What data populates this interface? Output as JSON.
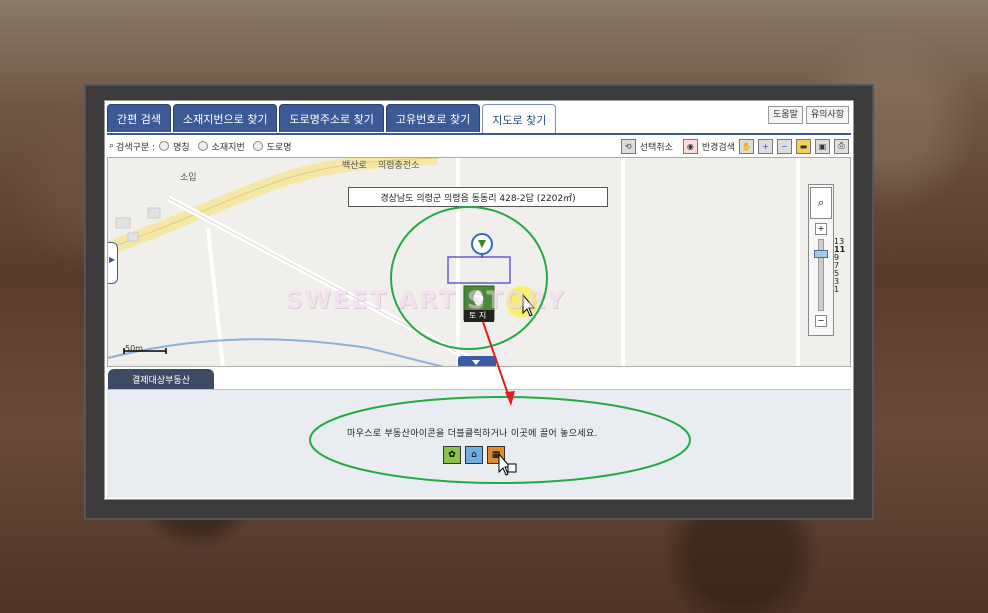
{
  "tabs": [
    {
      "label": "간편 검색",
      "active": false
    },
    {
      "label": "소재지번으로 찾기",
      "active": false
    },
    {
      "label": "도로명주소로 찾기",
      "active": false
    },
    {
      "label": "고유번호로 찾기",
      "active": false
    },
    {
      "label": "지도로 찾기",
      "active": true
    }
  ],
  "top_buttons": {
    "help": "도움말",
    "notice": "유의사항"
  },
  "search": {
    "label": "검색구분 :",
    "options": [
      "명칭",
      "소재지번",
      "도로명"
    ]
  },
  "tools": {
    "deselect": "선택취소",
    "radius_search": "반경검색"
  },
  "map": {
    "address": "경상남도 의령군 의령읍 동동리 428-2답 (2202㎡)",
    "labels": {
      "road": "백산로",
      "power": "의령충전소",
      "place": "소입"
    },
    "scale": "50m",
    "marker_caption": "토 지",
    "zoom_levels": [
      "13",
      "11",
      "9",
      "7",
      "5",
      "3",
      "1"
    ]
  },
  "bottom": {
    "tab": "결제대상부동산",
    "instruction": "마우스로 부동산아이콘을 더블클릭하거나 이곳에 끌어 놓으세요."
  },
  "watermark": "SWEET ART STORY",
  "colors": {
    "tab_blue": "#3c5a95",
    "highlight_green": "#22aa44",
    "arrow_red": "#e02020"
  }
}
